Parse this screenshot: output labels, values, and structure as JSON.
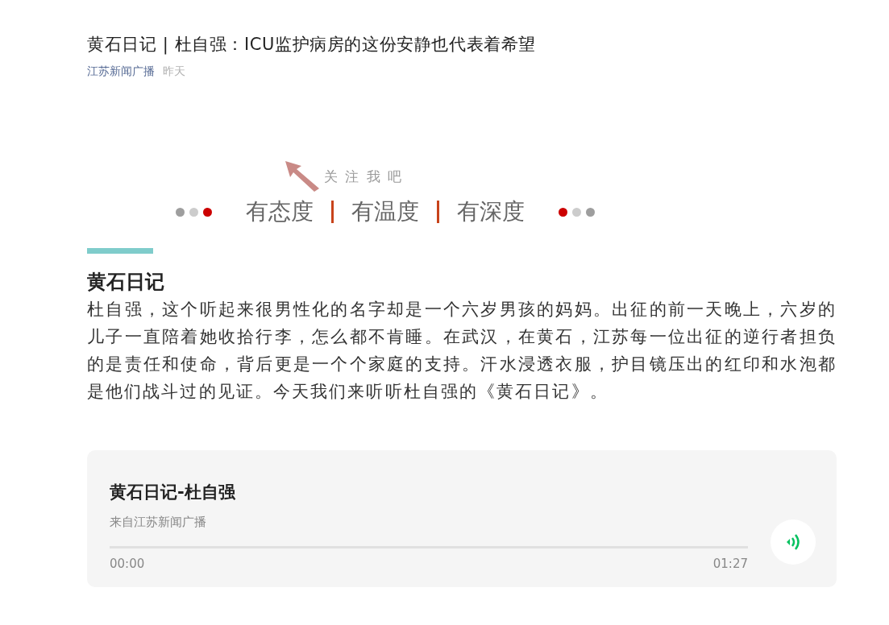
{
  "article": {
    "title": "黄石日记 | 杜自强：ICU监护病房的这份安静也代表着希望",
    "source": "江苏新闻广播",
    "time": "昨天"
  },
  "banner": {
    "follow_text": "关 注 我 吧",
    "left_dots": [
      {
        "color": "#9e9e9e"
      },
      {
        "color": "#cccccc"
      },
      {
        "color": "#cc0000"
      }
    ],
    "slogans": [
      "有态度",
      "有温度",
      "有深度"
    ],
    "right_dots": [
      {
        "color": "#cc0000"
      },
      {
        "color": "#cccccc"
      },
      {
        "color": "#9e9e9e"
      }
    ]
  },
  "section": {
    "heading": "黄石日记",
    "body": "杜自强，这个听起来很男性化的名字却是一个六岁男孩的妈妈。出征的前一天晚上，六岁的儿子一直陪着她收拾行李，怎么都不肯睡。在武汉，在黄石，江苏每一位出征的逆行者担负的是责任和使命，背后更是一个个家庭的支持。汗水浸透衣服，护目镜压出的红印和水泡都是他们战斗过的见证。今天我们来听听杜自强的《黄石日记》。"
  },
  "audio": {
    "title": "黄石日记-杜自强",
    "source": "来自江苏新闻广播",
    "level": 0,
    "current_time": "00:00",
    "duration": "01:27"
  }
}
